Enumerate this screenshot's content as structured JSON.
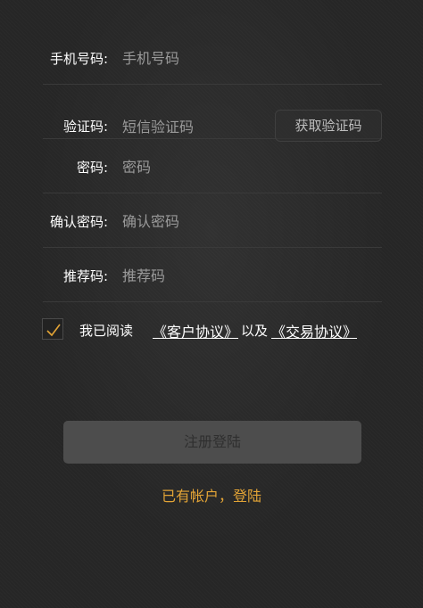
{
  "form": {
    "phone": {
      "label": "手机号码:",
      "placeholder": "手机号码"
    },
    "code": {
      "label": "验证码:",
      "placeholder": "短信验证码",
      "button": "获取验证码"
    },
    "password": {
      "label": "密码:",
      "placeholder": "密码"
    },
    "confirm": {
      "label": "确认密码:",
      "placeholder": "确认密码"
    },
    "referral": {
      "label": "推荐码:",
      "placeholder": "推荐码"
    }
  },
  "agreement": {
    "checked": true,
    "prefix": "我已阅读",
    "link1": "《客户协议》",
    "and": "以及",
    "link2": "《交易协议》"
  },
  "actions": {
    "register": "注册登陆",
    "login": "已有帐户，登陆"
  },
  "colors": {
    "accent": "#e3a436",
    "background": "#262626",
    "button": "#4d4d4d"
  }
}
